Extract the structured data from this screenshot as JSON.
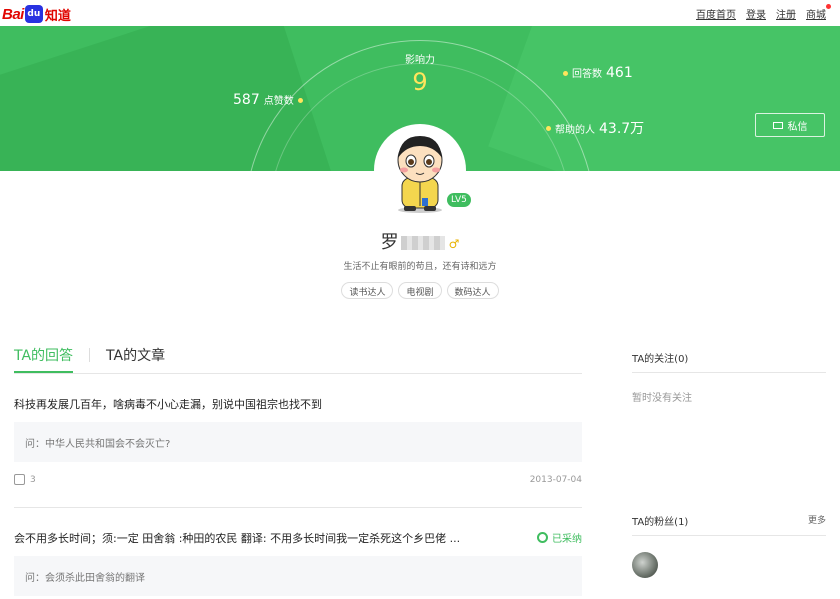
{
  "topbar": {
    "logo": {
      "bai": "Bai",
      "du": "du",
      "zhidao": "知道"
    },
    "links": [
      "百度首页",
      "登录",
      "注册",
      "商城"
    ]
  },
  "hero": {
    "influence": {
      "label": "影响力",
      "value": "9"
    },
    "likes": {
      "value": "587",
      "label": "点赞数"
    },
    "answers": {
      "label": "回答数",
      "value": "461"
    },
    "helped": {
      "label": "帮助的人",
      "value": "43.7万"
    },
    "message_button": "私信"
  },
  "profile": {
    "level": "LV5",
    "name": "罗",
    "gender_icon": "♂",
    "motto": "生活不止有眼前的苟且，还有诗和远方",
    "tags": [
      "读书达人",
      "电视剧",
      "数码达人"
    ]
  },
  "tabs": [
    "TA的回答",
    "TA的文章"
  ],
  "answers": [
    {
      "title": "科技再发展几百年，啥病毒不小心走漏，别说中国祖宗也找不到",
      "question": "问：中华人民共和国会不会灭亡?",
      "likes": "3",
      "date": "2013-07-04"
    },
    {
      "title": "会不用多长时间；须:一定 田舍翁 :种田的农民 翻译: 不用多长时间我一定杀死这个乡巴佬 ...",
      "question": "问：会须杀此田舍翁的翻译",
      "adopted": "已采纳"
    }
  ],
  "sidebar": {
    "following": {
      "title": "TA的关注(0)",
      "empty": "暂时没有关注"
    },
    "fans": {
      "title": "TA的粉丝(1)",
      "more": "更多"
    }
  },
  "colors": {
    "brand_green": "#3fbd5f",
    "accent_yellow": "#ffe55c",
    "baidu_red": "#e10601",
    "baidu_blue": "#2932e1"
  }
}
